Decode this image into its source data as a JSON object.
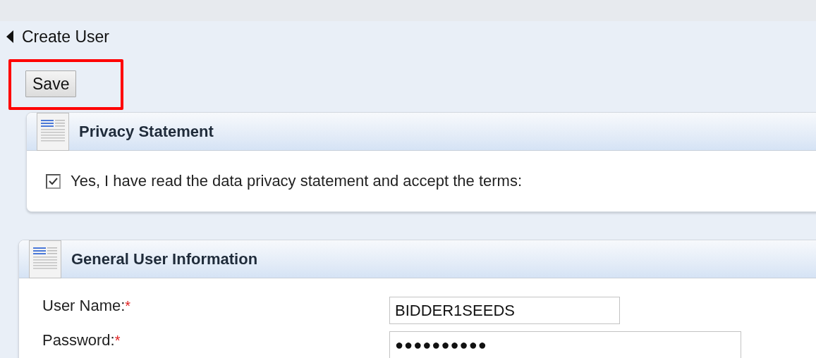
{
  "page": {
    "title": "Create User"
  },
  "toolbar": {
    "buttons": [
      "Save"
    ],
    "highlighted": true
  },
  "privacy_panel": {
    "title": "Privacy Statement",
    "checkbox": {
      "label": "Yes, I have read the data privacy statement and accept the terms:",
      "checked": true
    }
  },
  "user_panel": {
    "title": "General User Information",
    "fields": [
      {
        "kind": "text",
        "label": "User Name:",
        "required_mark": "*",
        "value": "BIDDER1SEEDS"
      },
      {
        "kind": "password",
        "label": "Password:",
        "required_mark": "*",
        "value": "●●●●●●●●●●"
      }
    ]
  }
}
